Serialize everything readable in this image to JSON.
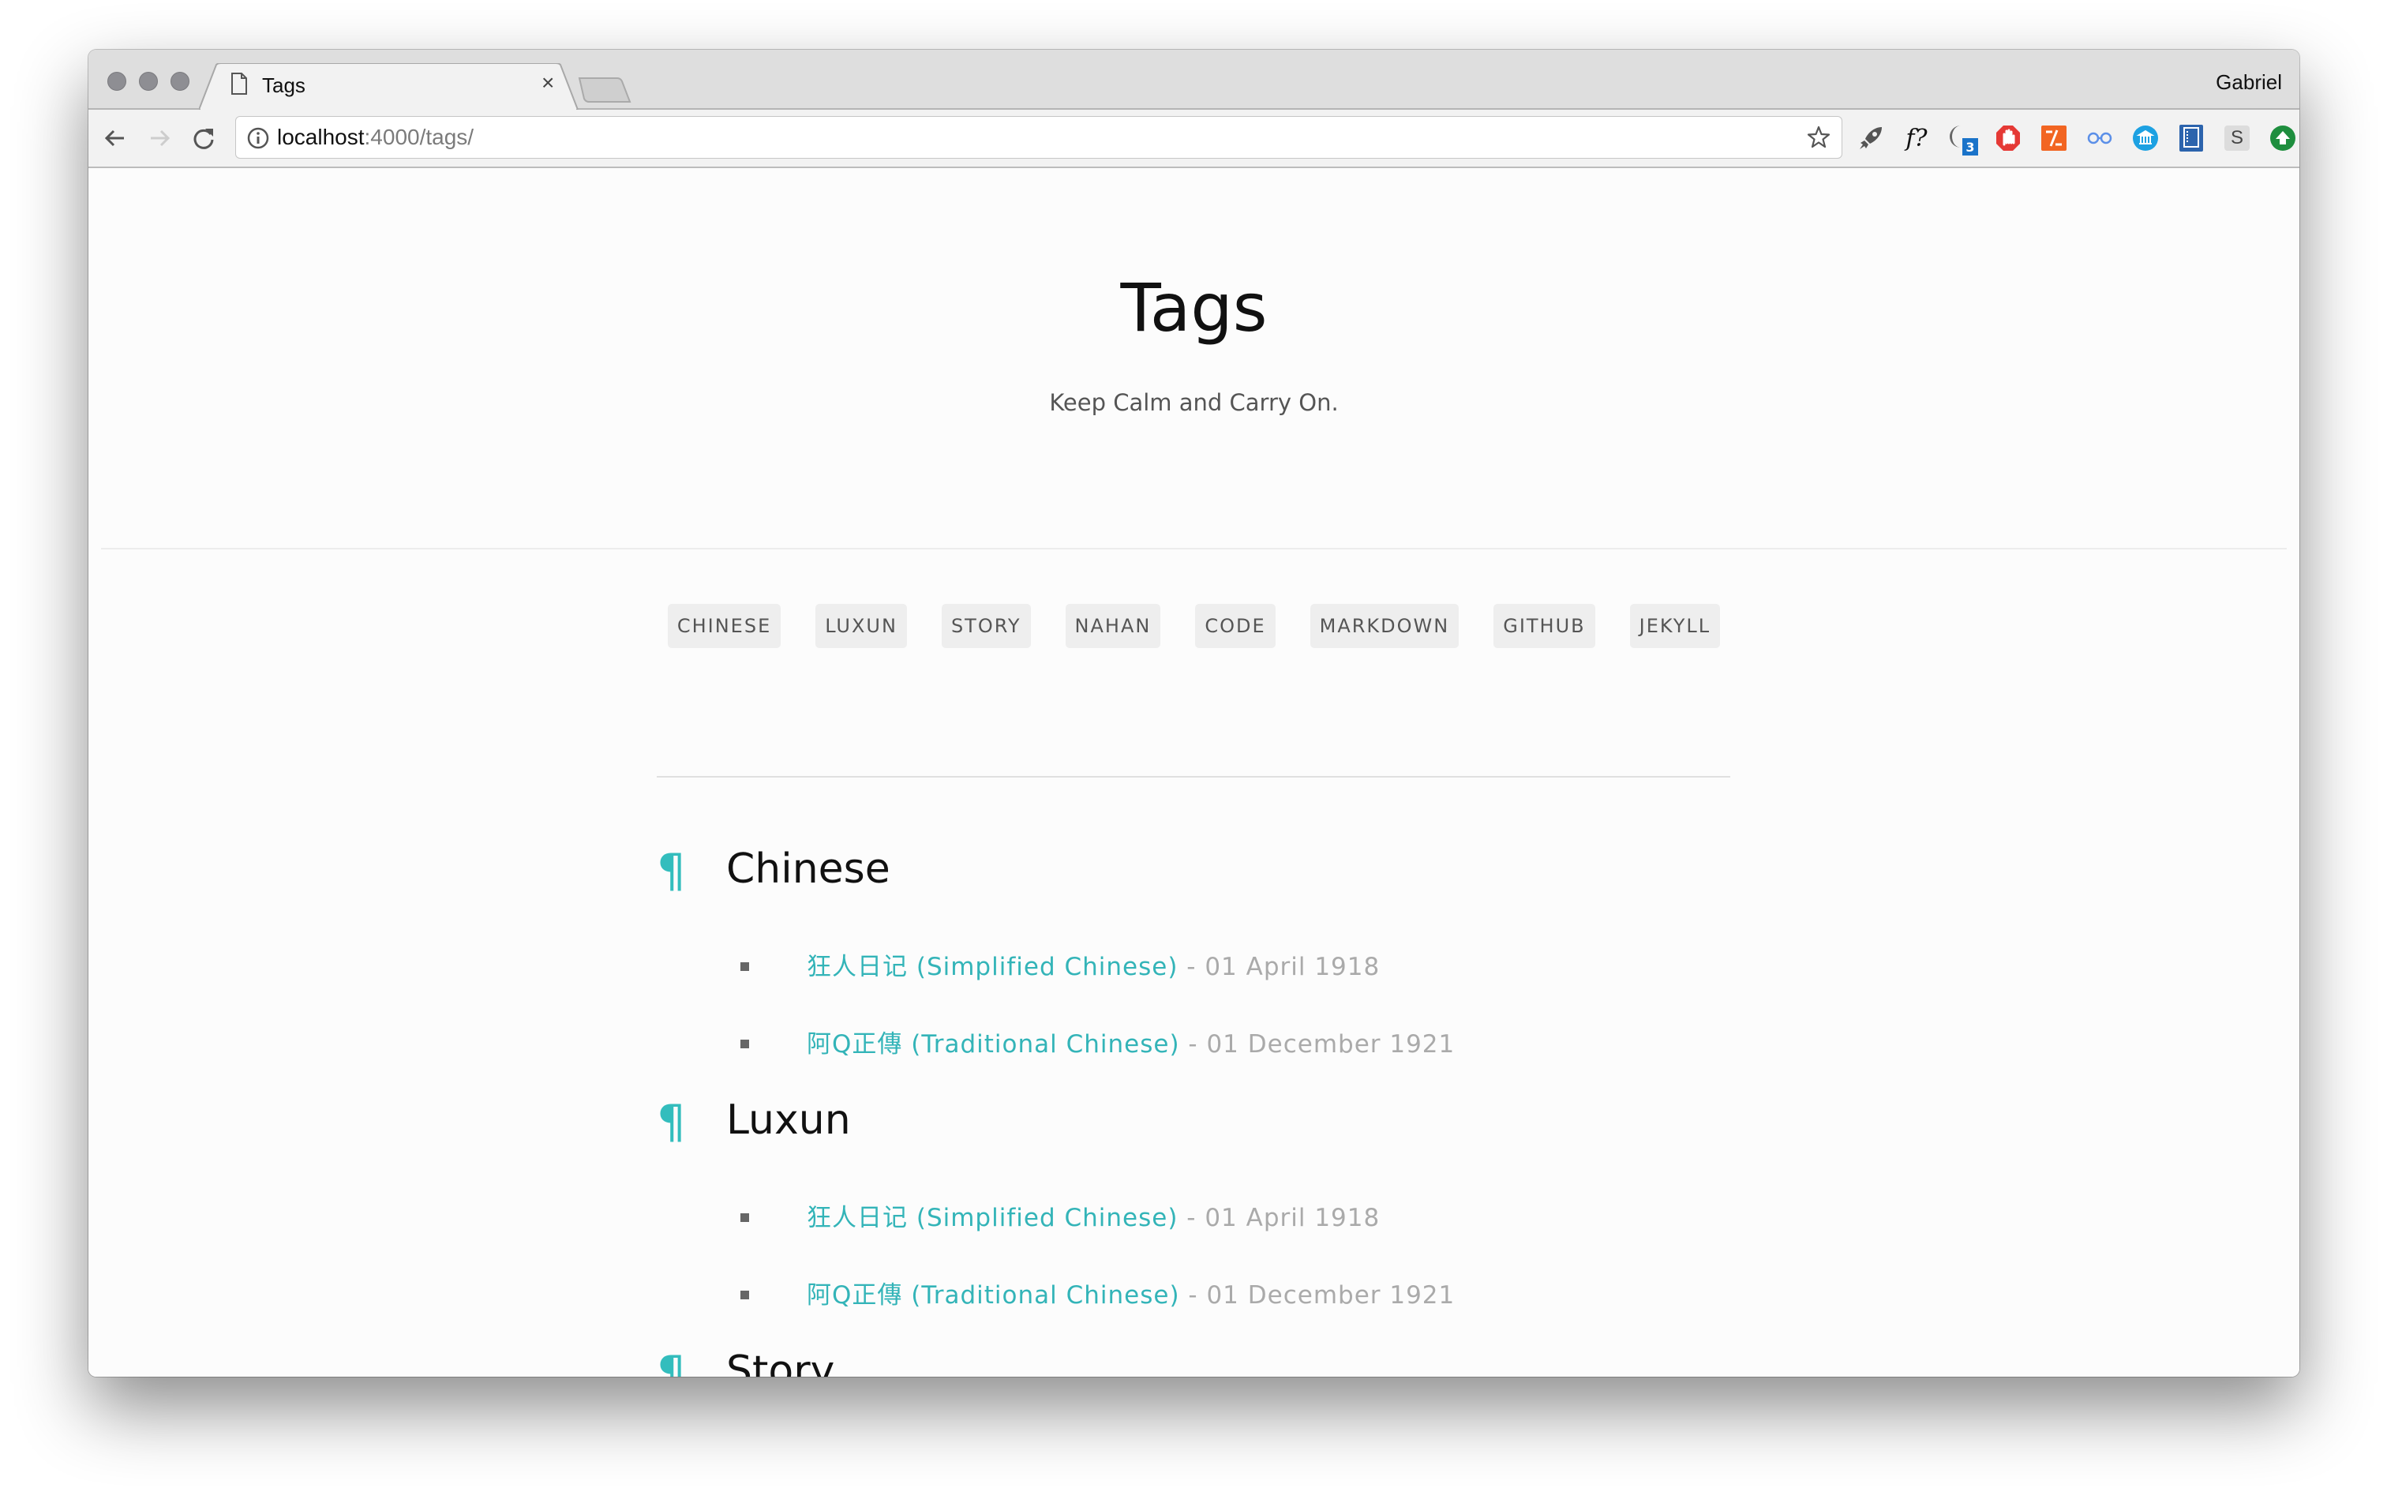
{
  "browser": {
    "tab_title": "Tags",
    "tab_close": "×",
    "profile_name": "Gabriel",
    "url_host": "localhost",
    "url_rest": ":4000/tags/",
    "extensions": [
      {
        "name": "rocket-extension-icon"
      },
      {
        "name": "fquestion-extension-icon",
        "label": "f?"
      },
      {
        "name": "moon-extension-icon",
        "badge": "3"
      },
      {
        "name": "adblock-extension-icon"
      },
      {
        "name": "code-extension-icon"
      },
      {
        "name": "glasses-extension-icon"
      },
      {
        "name": "bank-extension-icon"
      },
      {
        "name": "notebook-extension-icon"
      },
      {
        "name": "s-extension-icon",
        "label": "S"
      },
      {
        "name": "upload-extension-icon"
      }
    ]
  },
  "colors": {
    "accent": "#33bdbd",
    "link": "#33b4b8",
    "date": "#aaaaaa",
    "tag_bg": "#eeeeee"
  },
  "header": {
    "title": "Tags",
    "subtitle": "Keep Calm and Carry On."
  },
  "tags": [
    "CHINESE",
    "LUXUN",
    "STORY",
    "NAHAN",
    "CODE",
    "MARKDOWN",
    "GITHUB",
    "JEKYLL"
  ],
  "sections": [
    {
      "anchor": "¶",
      "title": "Chinese",
      "posts": [
        {
          "title": "狂人日记 (Simplified Chinese)",
          "date": " - 01 April 1918"
        },
        {
          "title": "阿Q正傳 (Traditional Chinese)",
          "date": " - 01 December 1921"
        }
      ]
    },
    {
      "anchor": "¶",
      "title": "Luxun",
      "posts": [
        {
          "title": "狂人日记 (Simplified Chinese)",
          "date": " - 01 April 1918"
        },
        {
          "title": "阿Q正傳 (Traditional Chinese)",
          "date": " - 01 December 1921"
        }
      ]
    },
    {
      "anchor": "¶",
      "title": "Story",
      "posts": []
    }
  ]
}
